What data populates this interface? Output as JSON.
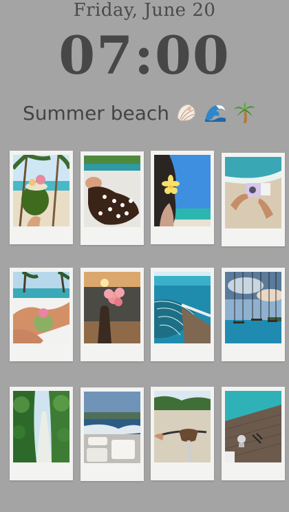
{
  "lockscreen": {
    "date": "Friday, June 20",
    "time": "07:00"
  },
  "caption": {
    "text": "Summer beach",
    "emoji_icons": [
      "seashell-icon",
      "wave-icon",
      "palm-tree-icon"
    ]
  },
  "photos": [
    {
      "name": "coconut-drink-palm-photo"
    },
    {
      "name": "flowers-in-hair-photo"
    },
    {
      "name": "frangipani-sea-view-photo"
    },
    {
      "name": "instant-camera-beach-photo"
    },
    {
      "name": "coconut-on-lounger-photo"
    },
    {
      "name": "hibiscus-sunset-photo"
    },
    {
      "name": "overwater-hammock-photo"
    },
    {
      "name": "sea-swings-photo"
    },
    {
      "name": "jungle-path-photo"
    },
    {
      "name": "boat-deck-photo"
    },
    {
      "name": "bicycle-beach-path-photo"
    },
    {
      "name": "wooden-deck-lagoon-photo"
    }
  ],
  "colors": {
    "background": "#a4a4a4",
    "text": "#474747",
    "frame": "#f3f3f1"
  }
}
